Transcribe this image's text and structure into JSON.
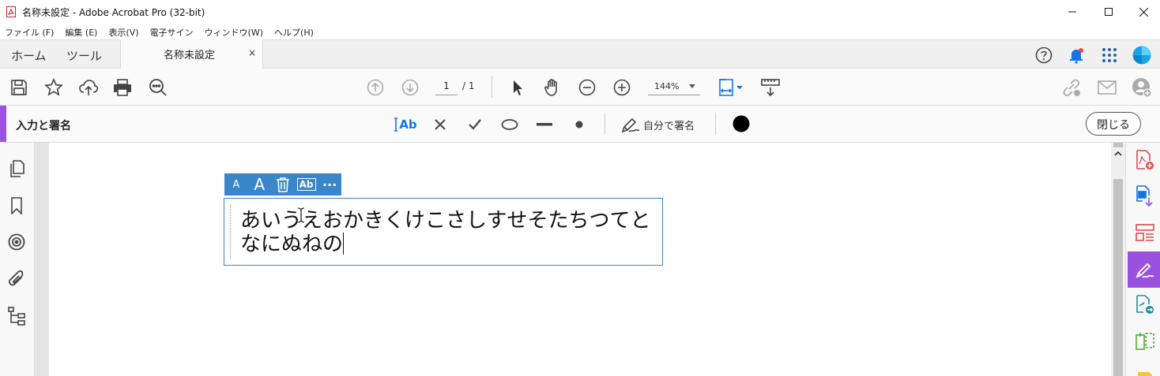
{
  "window": {
    "title": "名称未設定 - Adobe Acrobat Pro (32-bit)",
    "app_icon": "acrobat-icon",
    "controls": [
      "minimize-icon",
      "maximize-icon",
      "close-icon"
    ]
  },
  "menubar": {
    "items": [
      "ファイル (F)",
      "編集 (E)",
      "表示(V)",
      "電子サイン",
      "ウィンドウ(W)",
      "ヘルプ(H)"
    ]
  },
  "tabs": {
    "home": "ホーム",
    "tools": "ツール",
    "document": "名称未設定",
    "close_symbol": "×"
  },
  "header_icons": [
    "help-icon",
    "notification-bell-icon",
    "apps-grid-icon",
    "account-avatar-icon"
  ],
  "toolbar": {
    "page_current": "1",
    "page_total": "/ 1",
    "zoom": "144%",
    "icons": [
      "save-icon",
      "bookmark-star-icon",
      "upload-cloud-icon",
      "print-icon",
      "search-zoom-icon",
      "prev-page-icon",
      "next-page-icon",
      "select-cursor-icon",
      "hand-tool-icon",
      "zoom-out-icon",
      "zoom-in-icon",
      "fit-page-icon",
      "read-mode-icon",
      "share-link-icon",
      "email-icon",
      "add-user-icon"
    ]
  },
  "fill_sign": {
    "title": "入力と署名",
    "tool_text": "Ab",
    "tools": [
      "add-text-icon",
      "cross-mark-icon",
      "check-mark-icon",
      "ellipse-icon",
      "line-icon",
      "dot-icon"
    ],
    "sign_label": "自分で署名",
    "color": "#000000",
    "close_label": "閉じる",
    "accent": "#9b51e0"
  },
  "left_panel": [
    "page-thumbnails-icon",
    "bookmarks-icon",
    "layers-target-icon",
    "attachments-icon",
    "tags-tree-icon"
  ],
  "text_field": {
    "toolbar": {
      "decrease_label": "A",
      "increase_label": "A",
      "comb_label": "Ab",
      "more_label": "···"
    },
    "line1": "あいうえおかきくけこさしすせそたちつてと",
    "line2": "なにぬねの",
    "border_color": "#3a86c8"
  },
  "right_panel": [
    "create-pdf-icon",
    "export-pdf-icon",
    "organize-pages-icon",
    "fill-sign-icon",
    "send-for-signature-icon",
    "compare-files-icon",
    "comment-note-icon"
  ]
}
